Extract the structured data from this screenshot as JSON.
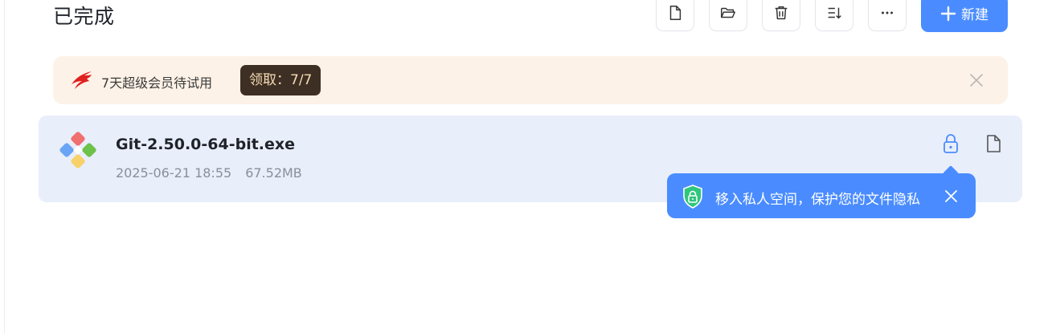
{
  "header": {
    "title": "已完成",
    "new_button_label": "新建",
    "toolbar_icons": [
      "new-file-icon",
      "open-folder-icon",
      "trash-icon",
      "sort-icon",
      "more-icon"
    ]
  },
  "promo": {
    "text": "7天超级会员待试用",
    "claim_label": "领取：7/7"
  },
  "files": [
    {
      "name": "Git-2.50.0-64-bit.exe",
      "date": "2025-06-21 18:55",
      "size": "67.52MB"
    }
  ],
  "tooltip": {
    "text": "移入私人空间，保护您的文件隐私"
  },
  "colors": {
    "accent": "#4a8cff",
    "promo_bg": "#fdf2e7",
    "row_bg": "#e9eefb",
    "claim_bg": "#3d2f23",
    "shield_green": "#2fc67d"
  }
}
